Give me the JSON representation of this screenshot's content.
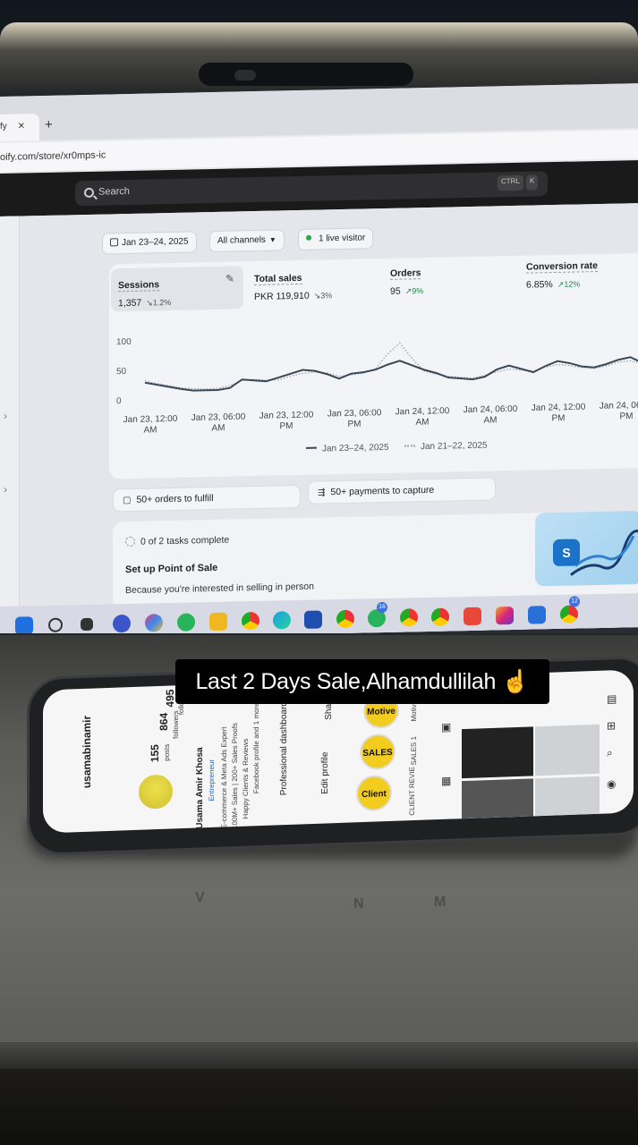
{
  "browser": {
    "tab_text": "fy",
    "tab_close": "×",
    "tab_new": "+",
    "url": "oify.com/store/xr0mps-ic"
  },
  "shopify": {
    "search_placeholder": "Search",
    "shortcut_ctrl": "CTRL",
    "shortcut_k": "K",
    "filters": {
      "date_range": "Jan 23–24, 2025",
      "channels": "All channels",
      "live": "1 live visitor"
    },
    "metrics": [
      {
        "title": "Sessions",
        "value": "1,357",
        "change": "↘1.2%"
      },
      {
        "title": "Total sales",
        "value": "PKR 119,910",
        "change": "↘3%"
      },
      {
        "title": "Orders",
        "value": "95",
        "change": "↗9%"
      },
      {
        "title": "Conversion rate",
        "value": "6.85%",
        "change": "↗12%"
      }
    ],
    "tasks": {
      "orders": "50+ orders to fulfill",
      "payments": "50+ payments to capture"
    },
    "setup": {
      "progress": "0 of 2 tasks complete",
      "title": "Set up Point of Sale",
      "subtitle": "Because you're interested in selling in person"
    },
    "pos_icon": "shopify-bag-icon",
    "bag_glyph": "S"
  },
  "chart_data": {
    "type": "line",
    "y_ticks": [
      "100",
      "50",
      "0"
    ],
    "ylim": [
      0,
      100
    ],
    "x_ticks": [
      [
        "Jan 23, 12:00",
        "AM"
      ],
      [
        "Jan 23, 06:00",
        "AM"
      ],
      [
        "Jan 23, 12:00",
        "PM"
      ],
      [
        "Jan 23, 06:00",
        "PM"
      ],
      [
        "Jan 24, 12:00",
        "AM"
      ],
      [
        "Jan 24, 06:00",
        "AM"
      ],
      [
        "Jan 24, 12:00",
        "PM"
      ],
      [
        "Jan 24, 06:00",
        "PM"
      ]
    ],
    "series": [
      {
        "name": "Jan 23–24, 2025",
        "style": "solid",
        "color": "#3a4756",
        "values": [
          30,
          26,
          22,
          18,
          15,
          15,
          15,
          18,
          32,
          30,
          28,
          34,
          40,
          46,
          44,
          38,
          30,
          38,
          40,
          44,
          52,
          58,
          50,
          42,
          36,
          28,
          26,
          24,
          28,
          40,
          46,
          40,
          34,
          44,
          52,
          48,
          42,
          40,
          45,
          52,
          56,
          46
        ]
      },
      {
        "name": "Jan 21–22, 2025",
        "style": "dotted",
        "color": "#9aa3ad",
        "values": [
          33,
          28,
          24,
          20,
          18,
          17,
          18,
          22,
          30,
          32,
          30,
          30,
          36,
          40,
          42,
          40,
          34,
          36,
          38,
          46,
          70,
          88,
          62,
          40,
          34,
          30,
          28,
          26,
          30,
          36,
          40,
          38,
          36,
          42,
          46,
          44,
          40,
          38,
          42,
          48,
          50,
          44
        ]
      }
    ]
  },
  "taskbar": {
    "badge_whatsapp": "16",
    "badge_chrome": "12"
  },
  "phone": {
    "username": "usamabinamir",
    "posts_count": "155",
    "posts_label": "posts",
    "followers_count": "864",
    "followers_label": "followers",
    "following_count": "495",
    "following_label": "following",
    "name": "Usama Amir Khosa",
    "category": "Entrepreneur",
    "bio_1": "E-commerce & Meta Ads Expert",
    "bio_2": "100M+ Sales | 200+ Sales Proofs",
    "bio_3": "Happy Clients & Reviews",
    "bio_4": "Facebook profile and 1 more link",
    "dashboard": "Professional dashboard",
    "edit_profile": "Edit profile",
    "share_profile": "Share pr",
    "highlights": [
      "Client",
      "SALES",
      "Motive"
    ],
    "highlight_sub": [
      "CLIENT REVIE",
      "SALES 1",
      "Motive"
    ]
  },
  "caption": "Last 2 Days Sale,Alhamdullilah ☝️"
}
